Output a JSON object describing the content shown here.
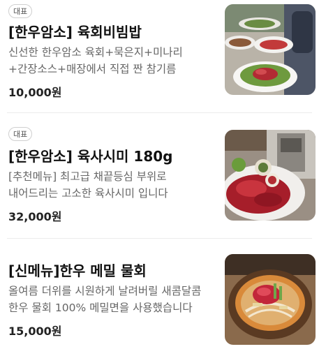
{
  "menu": [
    {
      "badge": "대표",
      "name": "[한우암소] 육회비빔밥",
      "description": "신선한 한우암소 육회+묵은지+미나리+간장소스+매장에서 직접 짠 참기름",
      "price": "10,000원",
      "image_icon": "yukhoe-bibimbap-photo"
    },
    {
      "badge": "대표",
      "name": "[한우암소] 육사시미 180g",
      "description": "[추천메뉴] 최고급 채끝등심 부위로 내어드리는 고소한 육사시미 입니다",
      "price": "32,000원",
      "image_icon": "yuksashimi-photo"
    },
    {
      "name": "[신메뉴]한우 메밀 물회",
      "description": "올여름 더위를 시원하게 날려버릴 새콤달콤 한우 물회 100% 메밀면을 사용했습니다",
      "price": "15,000원",
      "image_icon": "mulhoe-photo"
    }
  ]
}
